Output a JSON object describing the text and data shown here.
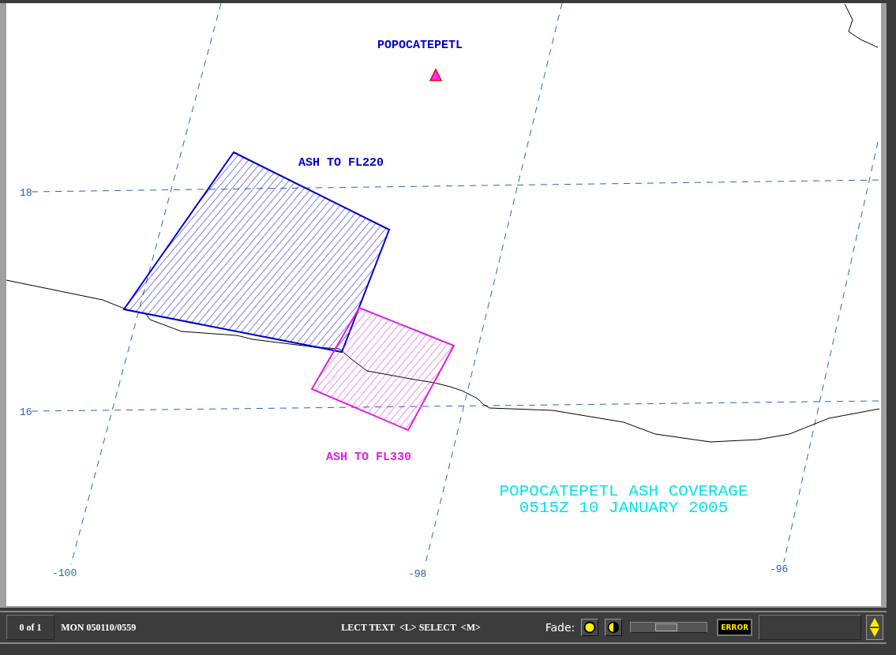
{
  "map": {
    "volcano": {
      "name": "POPOCATEPETL"
    },
    "ash_areas": [
      {
        "label": "ASH TO FL220",
        "color": "#0000cc"
      },
      {
        "label": "ASH TO FL330",
        "color": "#dd22dd"
      }
    ],
    "latitude_labels": [
      "18",
      "16"
    ],
    "longitude_labels": [
      "-100",
      "-98",
      "-96"
    ],
    "caption": [
      "POPOCATEPETL ASH COVERAGE",
      "0515Z 10 JANUARY 2005"
    ]
  },
  "status_bar": {
    "frame_counter": "0 of 1",
    "datetime": "MON 050110/0559",
    "hint": "LECT TEXT  <L> SELECT  <M>",
    "fade_label": "Fade:",
    "fade_slider": {
      "level": 0.45
    },
    "error_button": "ERROR"
  }
}
